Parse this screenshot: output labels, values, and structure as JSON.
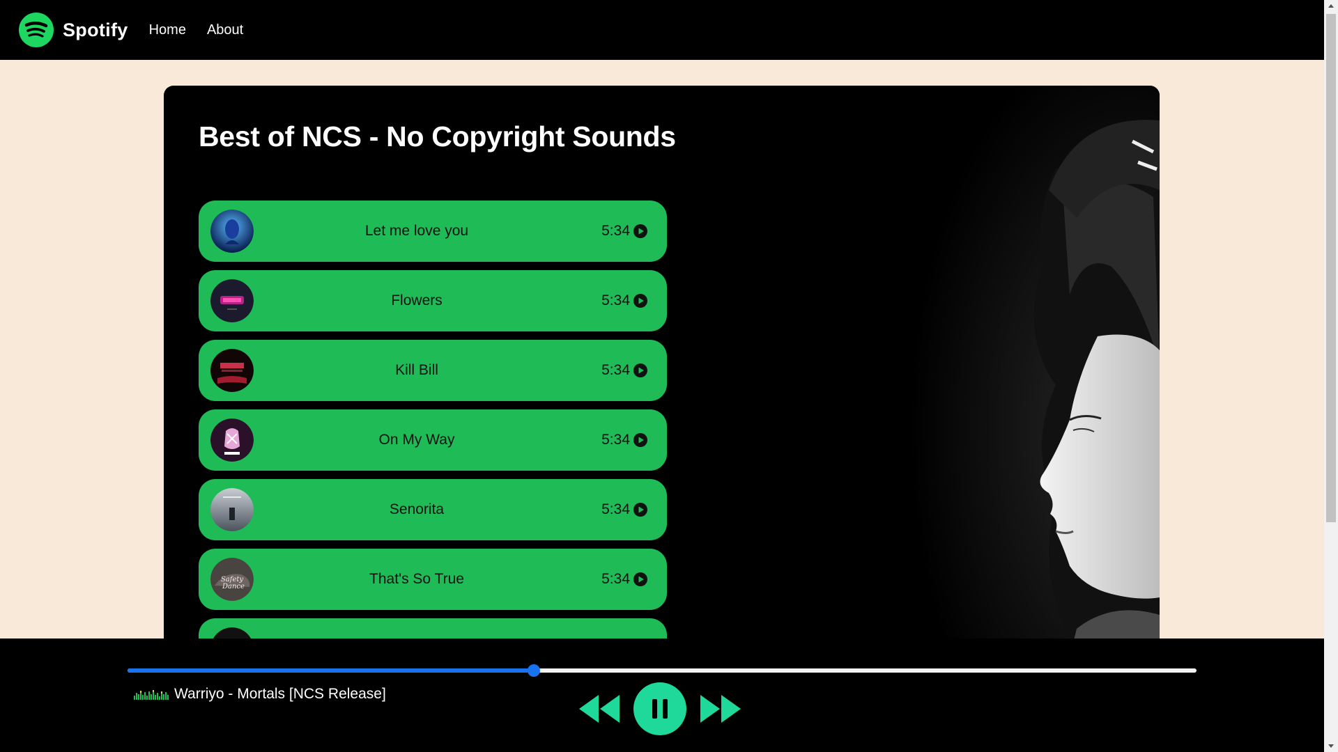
{
  "navbar": {
    "brand": "Spotify",
    "links": [
      "Home",
      "About"
    ],
    "brand_color": "#1ed760"
  },
  "playlist": {
    "title": "Best of NCS - No Copyright Sounds",
    "songs": [
      {
        "name": "Let me love you",
        "duration": "5:34",
        "icon": "play-circle-icon"
      },
      {
        "name": "Flowers",
        "duration": "5:34",
        "icon": "play-circle-icon"
      },
      {
        "name": "Kill Bill",
        "duration": "5:34",
        "icon": "play-circle-icon"
      },
      {
        "name": "On My Way",
        "duration": "5:34",
        "icon": "play-circle-icon"
      },
      {
        "name": "Senorita",
        "duration": "5:34",
        "icon": "play-circle-icon"
      },
      {
        "name": "That's So True",
        "duration": "5:34",
        "icon": "play-circle-icon"
      }
    ],
    "card_bg": "#000000",
    "song_bg": "#1fbb57"
  },
  "player": {
    "now_playing": "Warriyo - Mortals [NCS Release]",
    "progress": 0.38,
    "accent": "#1773ee",
    "control_color": "#1ed999",
    "controls": [
      "backward-icon",
      "pause-icon",
      "forward-icon"
    ]
  }
}
